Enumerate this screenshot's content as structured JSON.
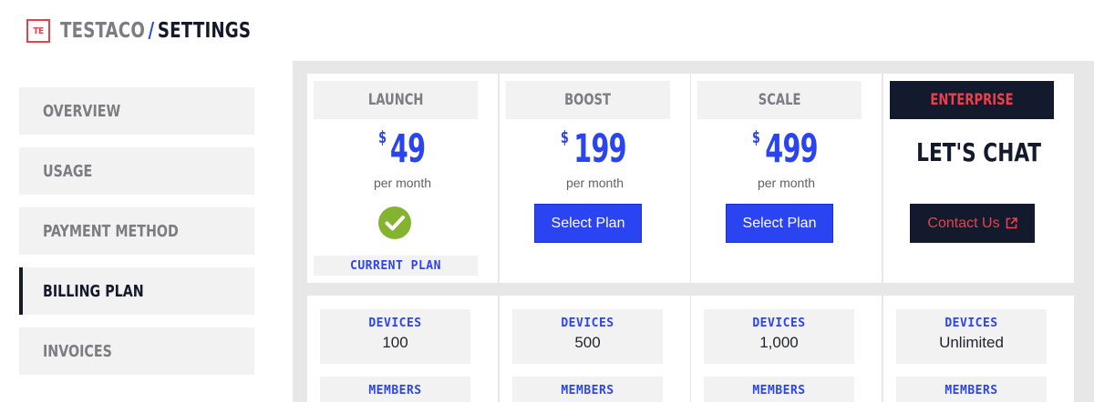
{
  "header": {
    "logo_text": "TE",
    "brand": "TESTACO",
    "separator": "/",
    "page": "SETTINGS"
  },
  "sidebar": {
    "items": [
      {
        "label": "OVERVIEW",
        "active": false
      },
      {
        "label": "USAGE",
        "active": false
      },
      {
        "label": "PAYMENT METHOD",
        "active": false
      },
      {
        "label": "BILLING PLAN",
        "active": true
      },
      {
        "label": "INVOICES",
        "active": false
      }
    ]
  },
  "plans": [
    {
      "name": "LAUNCH",
      "currency": "$",
      "price": "49",
      "period": "per month",
      "status": "CURRENT PLAN"
    },
    {
      "name": "BOOST",
      "currency": "$",
      "price": "199",
      "period": "per month",
      "cta": "Select Plan"
    },
    {
      "name": "SCALE",
      "currency": "$",
      "price": "499",
      "period": "per month",
      "cta": "Select Plan"
    },
    {
      "name": "ENTERPRISE",
      "headline": "LET'S CHAT",
      "cta": "Contact Us"
    }
  ],
  "features": [
    {
      "devices_label": "DEVICES",
      "devices_value": "100",
      "members_label": "MEMBERS"
    },
    {
      "devices_label": "DEVICES",
      "devices_value": "500",
      "members_label": "MEMBERS"
    },
    {
      "devices_label": "DEVICES",
      "devices_value": "1,000",
      "members_label": "MEMBERS"
    },
    {
      "devices_label": "DEVICES",
      "devices_value": "Unlimited",
      "members_label": "MEMBERS"
    }
  ],
  "colors": {
    "accent": "#2b44f1",
    "brand_red": "#e8414a",
    "dark": "#141a2d",
    "check_green": "#84b32f"
  },
  "icons": {
    "check": "check-circle-icon",
    "external": "external-link-icon"
  }
}
